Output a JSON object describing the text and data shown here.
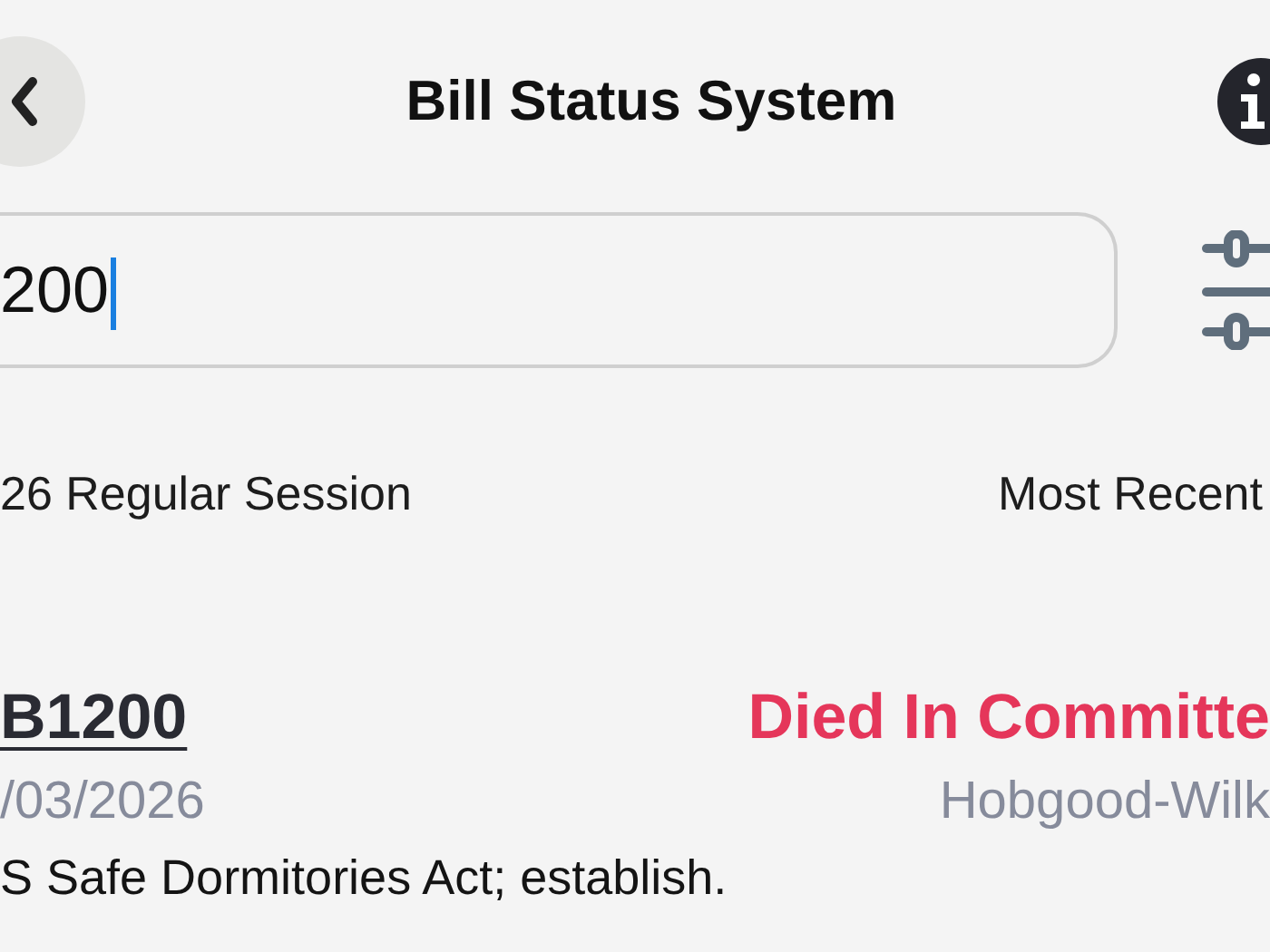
{
  "header": {
    "title": "Bill Status System"
  },
  "search": {
    "value": "200",
    "focused": true
  },
  "session": {
    "label": "26 Regular Session",
    "sort": "Most Recent"
  },
  "bills": [
    {
      "number": "B1200",
      "status": "Died In Committe",
      "date": "/03/2026",
      "sponsor": "Hobgood-Wilk",
      "description": "S Safe Dormitories Act; establish."
    }
  ]
}
